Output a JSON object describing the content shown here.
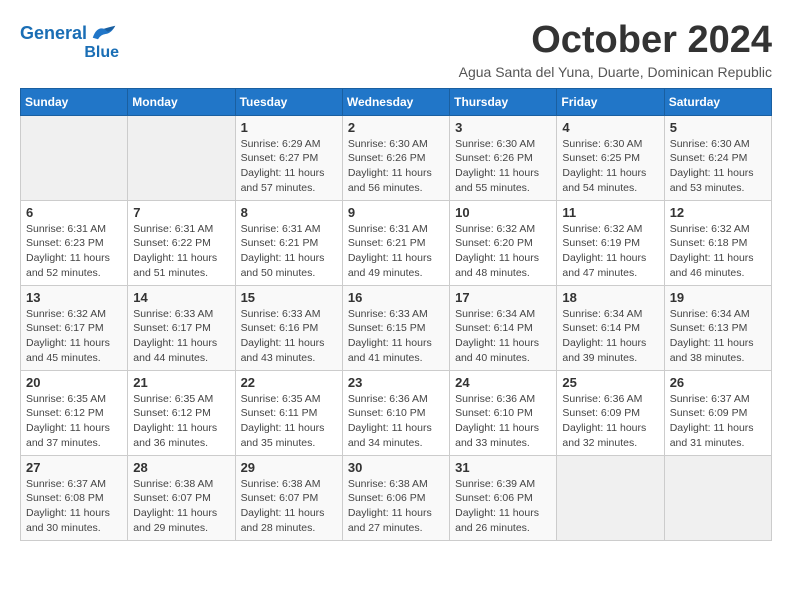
{
  "logo": {
    "text1": "General",
    "text2": "Blue"
  },
  "title": "October 2024",
  "subtitle": "Agua Santa del Yuna, Duarte, Dominican Republic",
  "weekdays": [
    "Sunday",
    "Monday",
    "Tuesday",
    "Wednesday",
    "Thursday",
    "Friday",
    "Saturday"
  ],
  "weeks": [
    [
      {
        "day": "",
        "sunrise": "",
        "sunset": "",
        "daylight": ""
      },
      {
        "day": "",
        "sunrise": "",
        "sunset": "",
        "daylight": ""
      },
      {
        "day": "1",
        "sunrise": "Sunrise: 6:29 AM",
        "sunset": "Sunset: 6:27 PM",
        "daylight": "Daylight: 11 hours and 57 minutes."
      },
      {
        "day": "2",
        "sunrise": "Sunrise: 6:30 AM",
        "sunset": "Sunset: 6:26 PM",
        "daylight": "Daylight: 11 hours and 56 minutes."
      },
      {
        "day": "3",
        "sunrise": "Sunrise: 6:30 AM",
        "sunset": "Sunset: 6:26 PM",
        "daylight": "Daylight: 11 hours and 55 minutes."
      },
      {
        "day": "4",
        "sunrise": "Sunrise: 6:30 AM",
        "sunset": "Sunset: 6:25 PM",
        "daylight": "Daylight: 11 hours and 54 minutes."
      },
      {
        "day": "5",
        "sunrise": "Sunrise: 6:30 AM",
        "sunset": "Sunset: 6:24 PM",
        "daylight": "Daylight: 11 hours and 53 minutes."
      }
    ],
    [
      {
        "day": "6",
        "sunrise": "Sunrise: 6:31 AM",
        "sunset": "Sunset: 6:23 PM",
        "daylight": "Daylight: 11 hours and 52 minutes."
      },
      {
        "day": "7",
        "sunrise": "Sunrise: 6:31 AM",
        "sunset": "Sunset: 6:22 PM",
        "daylight": "Daylight: 11 hours and 51 minutes."
      },
      {
        "day": "8",
        "sunrise": "Sunrise: 6:31 AM",
        "sunset": "Sunset: 6:21 PM",
        "daylight": "Daylight: 11 hours and 50 minutes."
      },
      {
        "day": "9",
        "sunrise": "Sunrise: 6:31 AM",
        "sunset": "Sunset: 6:21 PM",
        "daylight": "Daylight: 11 hours and 49 minutes."
      },
      {
        "day": "10",
        "sunrise": "Sunrise: 6:32 AM",
        "sunset": "Sunset: 6:20 PM",
        "daylight": "Daylight: 11 hours and 48 minutes."
      },
      {
        "day": "11",
        "sunrise": "Sunrise: 6:32 AM",
        "sunset": "Sunset: 6:19 PM",
        "daylight": "Daylight: 11 hours and 47 minutes."
      },
      {
        "day": "12",
        "sunrise": "Sunrise: 6:32 AM",
        "sunset": "Sunset: 6:18 PM",
        "daylight": "Daylight: 11 hours and 46 minutes."
      }
    ],
    [
      {
        "day": "13",
        "sunrise": "Sunrise: 6:32 AM",
        "sunset": "Sunset: 6:17 PM",
        "daylight": "Daylight: 11 hours and 45 minutes."
      },
      {
        "day": "14",
        "sunrise": "Sunrise: 6:33 AM",
        "sunset": "Sunset: 6:17 PM",
        "daylight": "Daylight: 11 hours and 44 minutes."
      },
      {
        "day": "15",
        "sunrise": "Sunrise: 6:33 AM",
        "sunset": "Sunset: 6:16 PM",
        "daylight": "Daylight: 11 hours and 43 minutes."
      },
      {
        "day": "16",
        "sunrise": "Sunrise: 6:33 AM",
        "sunset": "Sunset: 6:15 PM",
        "daylight": "Daylight: 11 hours and 41 minutes."
      },
      {
        "day": "17",
        "sunrise": "Sunrise: 6:34 AM",
        "sunset": "Sunset: 6:14 PM",
        "daylight": "Daylight: 11 hours and 40 minutes."
      },
      {
        "day": "18",
        "sunrise": "Sunrise: 6:34 AM",
        "sunset": "Sunset: 6:14 PM",
        "daylight": "Daylight: 11 hours and 39 minutes."
      },
      {
        "day": "19",
        "sunrise": "Sunrise: 6:34 AM",
        "sunset": "Sunset: 6:13 PM",
        "daylight": "Daylight: 11 hours and 38 minutes."
      }
    ],
    [
      {
        "day": "20",
        "sunrise": "Sunrise: 6:35 AM",
        "sunset": "Sunset: 6:12 PM",
        "daylight": "Daylight: 11 hours and 37 minutes."
      },
      {
        "day": "21",
        "sunrise": "Sunrise: 6:35 AM",
        "sunset": "Sunset: 6:12 PM",
        "daylight": "Daylight: 11 hours and 36 minutes."
      },
      {
        "day": "22",
        "sunrise": "Sunrise: 6:35 AM",
        "sunset": "Sunset: 6:11 PM",
        "daylight": "Daylight: 11 hours and 35 minutes."
      },
      {
        "day": "23",
        "sunrise": "Sunrise: 6:36 AM",
        "sunset": "Sunset: 6:10 PM",
        "daylight": "Daylight: 11 hours and 34 minutes."
      },
      {
        "day": "24",
        "sunrise": "Sunrise: 6:36 AM",
        "sunset": "Sunset: 6:10 PM",
        "daylight": "Daylight: 11 hours and 33 minutes."
      },
      {
        "day": "25",
        "sunrise": "Sunrise: 6:36 AM",
        "sunset": "Sunset: 6:09 PM",
        "daylight": "Daylight: 11 hours and 32 minutes."
      },
      {
        "day": "26",
        "sunrise": "Sunrise: 6:37 AM",
        "sunset": "Sunset: 6:09 PM",
        "daylight": "Daylight: 11 hours and 31 minutes."
      }
    ],
    [
      {
        "day": "27",
        "sunrise": "Sunrise: 6:37 AM",
        "sunset": "Sunset: 6:08 PM",
        "daylight": "Daylight: 11 hours and 30 minutes."
      },
      {
        "day": "28",
        "sunrise": "Sunrise: 6:38 AM",
        "sunset": "Sunset: 6:07 PM",
        "daylight": "Daylight: 11 hours and 29 minutes."
      },
      {
        "day": "29",
        "sunrise": "Sunrise: 6:38 AM",
        "sunset": "Sunset: 6:07 PM",
        "daylight": "Daylight: 11 hours and 28 minutes."
      },
      {
        "day": "30",
        "sunrise": "Sunrise: 6:38 AM",
        "sunset": "Sunset: 6:06 PM",
        "daylight": "Daylight: 11 hours and 27 minutes."
      },
      {
        "day": "31",
        "sunrise": "Sunrise: 6:39 AM",
        "sunset": "Sunset: 6:06 PM",
        "daylight": "Daylight: 11 hours and 26 minutes."
      },
      {
        "day": "",
        "sunrise": "",
        "sunset": "",
        "daylight": ""
      },
      {
        "day": "",
        "sunrise": "",
        "sunset": "",
        "daylight": ""
      }
    ]
  ]
}
